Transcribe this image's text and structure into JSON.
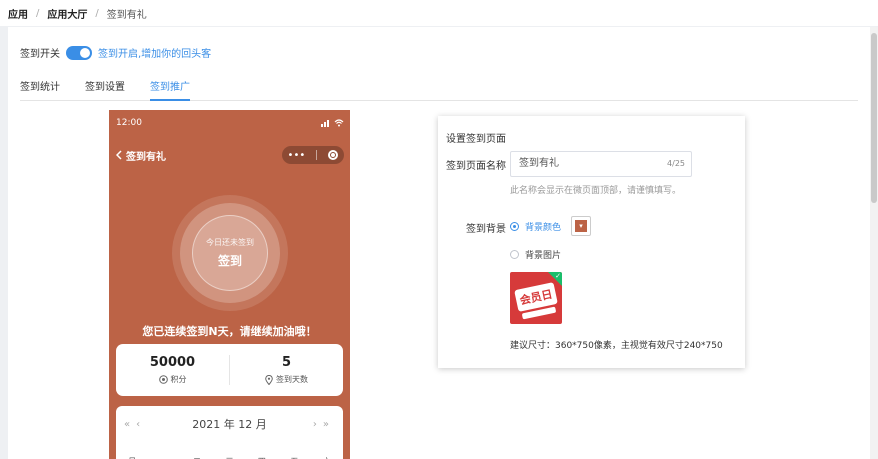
{
  "breadcrumb": {
    "level1": "应用",
    "level2": "应用大厅",
    "current": "签到有礼"
  },
  "switch": {
    "label": "签到开关",
    "hint": "签到开启,增加你的回头客",
    "enabled": true
  },
  "tabs": [
    {
      "label": "签到统计",
      "active": false
    },
    {
      "label": "签到设置",
      "active": false
    },
    {
      "label": "签到推广",
      "active": true
    }
  ],
  "phone": {
    "time": "12:00",
    "title": "签到有礼",
    "capsule_more": "•••",
    "sign_sub": "今日还未签到",
    "sign_main": "签到",
    "streak_text": "您已连续签到N天，请继续加油哦！",
    "points_value": "50000",
    "points_label": "积分",
    "days_value": "5",
    "days_label": "签到天数",
    "calendar_year": "2021",
    "calendar_year_unit": "年",
    "calendar_month": "12",
    "calendar_month_unit": "月",
    "weekdays": [
      "日",
      "一",
      "二",
      "三",
      "四",
      "五",
      "六"
    ],
    "background_color": "#bc6346"
  },
  "settings": {
    "title": "设置签到页面",
    "name_label": "签到页面名称",
    "name_value": "签到有礼",
    "name_count": "4/25",
    "name_tip": "此名称会显示在微页面顶部，请谨慎填写。",
    "bg_label": "签到背景",
    "bg_color_option": "背景颜色",
    "bg_image_option": "背景图片",
    "image_text": "会员日",
    "size_tip": "建议尺寸：360*750像素，主视觉有效尺寸240*750"
  },
  "colors": {
    "accent": "#3a8ee6",
    "theme": "#bc6346"
  }
}
